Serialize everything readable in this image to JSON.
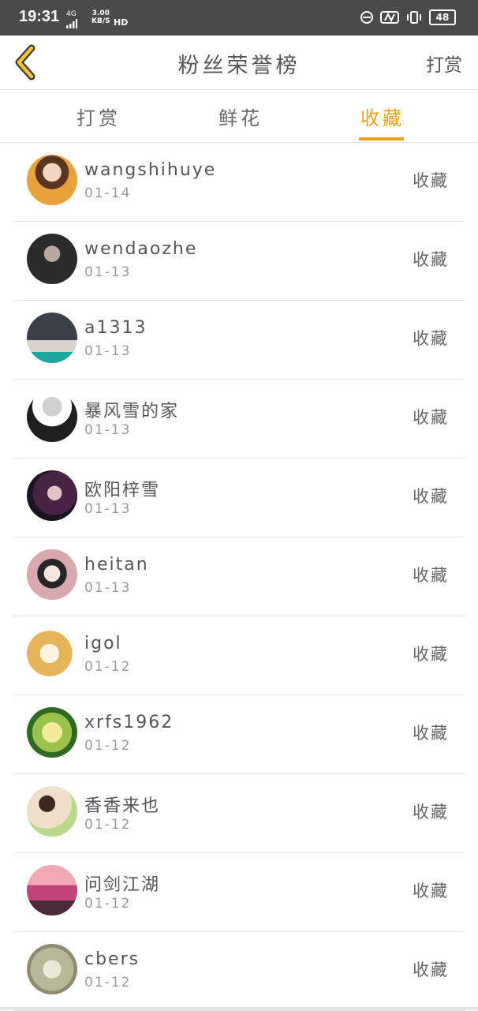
{
  "status_bar": {
    "time": "19:31",
    "network": "4G",
    "speed_value": "3.00",
    "speed_unit": "KB/S",
    "hd": "HD",
    "battery": "48"
  },
  "header": {
    "title": "粉丝荣誉榜",
    "right_action": "打赏"
  },
  "tabs": [
    {
      "label": "打赏"
    },
    {
      "label": "鲜花"
    },
    {
      "label": "收藏",
      "active": true
    }
  ],
  "accent_color": "#f2a111",
  "fans": [
    {
      "name": "wangshihuye",
      "date": "01-14",
      "action": "收藏"
    },
    {
      "name": "wendaozhe",
      "date": "01-13",
      "action": "收藏"
    },
    {
      "name": "a1313",
      "date": "01-13",
      "action": "收藏"
    },
    {
      "name": "暴风雪的家",
      "date": "01-13",
      "action": "收藏"
    },
    {
      "name": "欧阳梓雪",
      "date": "01-13",
      "action": "收藏"
    },
    {
      "name": "heitan",
      "date": "01-13",
      "action": "收藏"
    },
    {
      "name": "igol",
      "date": "01-12",
      "action": "收藏"
    },
    {
      "name": "xrfs1962",
      "date": "01-12",
      "action": "收藏"
    },
    {
      "name": "香香来也",
      "date": "01-12",
      "action": "收藏"
    },
    {
      "name": "问剑江湖",
      "date": "01-12",
      "action": "收藏"
    },
    {
      "name": "cbers",
      "date": "01-12",
      "action": "收藏"
    }
  ]
}
